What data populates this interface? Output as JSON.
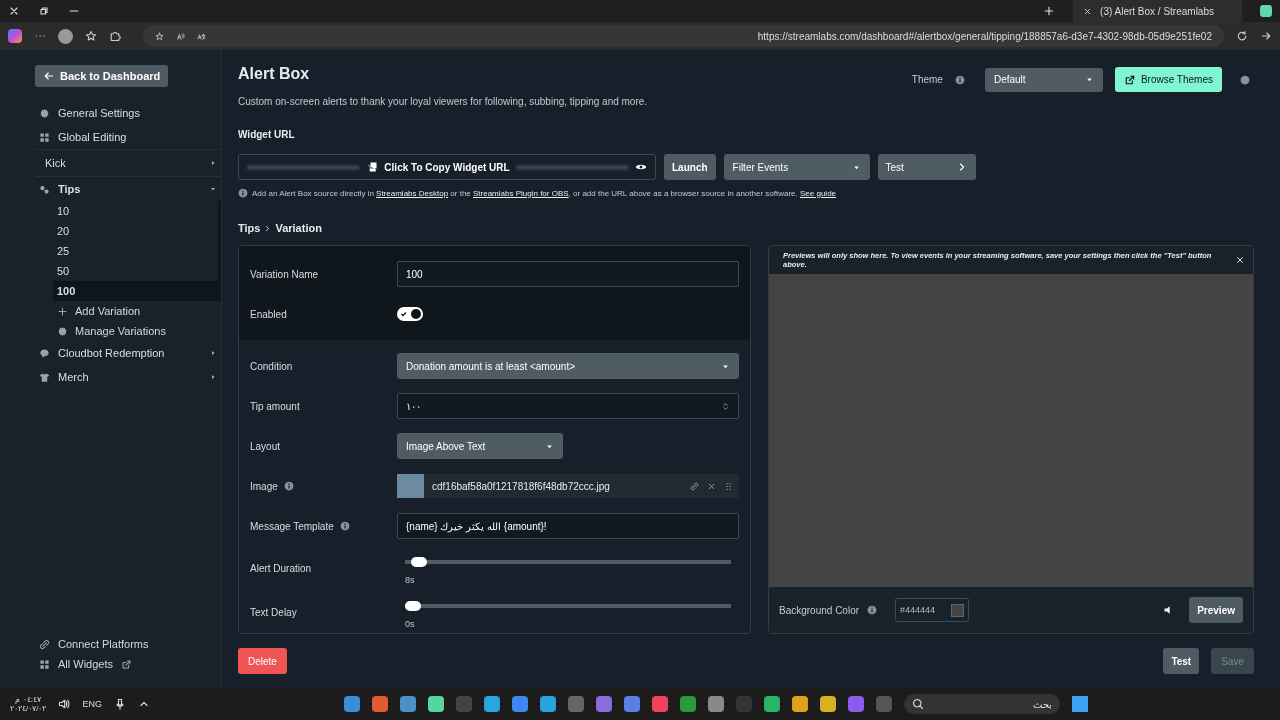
{
  "browser": {
    "tab_title": "(3) Alert Box / Streamlabs",
    "url": "https://streamlabs.com/dashboard#/alertbox/general/tipping/188857a6-d3e7-4302-98db-05d9e251fe02"
  },
  "sidebar": {
    "back": "Back to Dashboard",
    "items": [
      {
        "label": "General Settings",
        "expanded": false,
        "arrow": false
      },
      {
        "label": "Global Editing",
        "expanded": false,
        "arrow": false
      },
      {
        "label": "Kick",
        "expanded": false,
        "arrow": true
      },
      {
        "label": "Tips",
        "expanded": true,
        "arrow": true,
        "children": [
          {
            "label": "10",
            "selected": false
          },
          {
            "label": "20",
            "selected": false
          },
          {
            "label": "25",
            "selected": false
          },
          {
            "label": "50",
            "selected": false
          },
          {
            "label": "100",
            "selected": true
          }
        ],
        "actions": [
          "Add Variation",
          "Manage Variations"
        ]
      },
      {
        "label": "Cloudbot Redemption",
        "expanded": false,
        "arrow": true
      },
      {
        "label": "Merch",
        "expanded": false,
        "arrow": true
      }
    ],
    "footer": [
      "Connect Platforms",
      "All Widgets"
    ]
  },
  "header": {
    "title": "Alert Box",
    "subtitle": "Custom on-screen alerts to thank your loyal viewers for following, subbing, tipping and more.",
    "theme_label": "Theme",
    "theme_value": "Default",
    "browse_themes": "Browse Themes"
  },
  "widget_url": {
    "label": "Widget URL",
    "copy": "Click To Copy Widget URL",
    "launch": "Launch",
    "filter": "Filter Events",
    "test": "Test",
    "hint": [
      "Add an Alert Box source directly in ",
      {
        "link": "Streamlabs Desktop"
      },
      " or the ",
      {
        "link": "Streamlabs Plugin for OBS"
      },
      ", or add the URL above as a browser source in another software. ",
      {
        "link": "See guide"
      }
    ]
  },
  "breadcrumb": [
    "Tips",
    "Variation"
  ],
  "form": {
    "top": [
      {
        "kind": "text",
        "label": "Variation Name",
        "value": "100"
      },
      {
        "kind": "toggle",
        "label": "Enabled",
        "on": true
      }
    ],
    "rows": [
      {
        "kind": "select",
        "label": "Condition",
        "value": "Donation amount is at least <amount>",
        "wide": true
      },
      {
        "kind": "number",
        "label": "Tip amount",
        "value": "١٠٠"
      },
      {
        "kind": "select",
        "label": "Layout",
        "value": "Image Above Text",
        "wide": false
      },
      {
        "kind": "image",
        "label": "Image",
        "info": true,
        "value": "cdf16baf58a0f1217818f6f48db72ccc.jpg"
      },
      {
        "kind": "text",
        "label": "Message Template",
        "info": true,
        "value": "{name} الله يكثر خيرك {amount}!"
      },
      {
        "kind": "slider",
        "label": "Alert Duration",
        "level": 0.02,
        "reading": "8s"
      },
      {
        "kind": "slider",
        "label": "Text Delay",
        "level": 0,
        "reading": "0s"
      }
    ]
  },
  "preview": {
    "notice": "Previews will only show here. To view events in your streaming software, save your settings then click the \"Test\" button above.",
    "bg_label": "Background Color",
    "bg_value": "#444444",
    "preview": "Preview"
  },
  "bottom": {
    "delete": "Delete",
    "test": "Test",
    "save": "Save",
    "save_disabled": true
  },
  "taskbar": {
    "time": "٠٤:٤٧ م",
    "date": "٢٠٢٤/٠٧/٠٢",
    "lang": "ENG",
    "search": "بحث"
  }
}
